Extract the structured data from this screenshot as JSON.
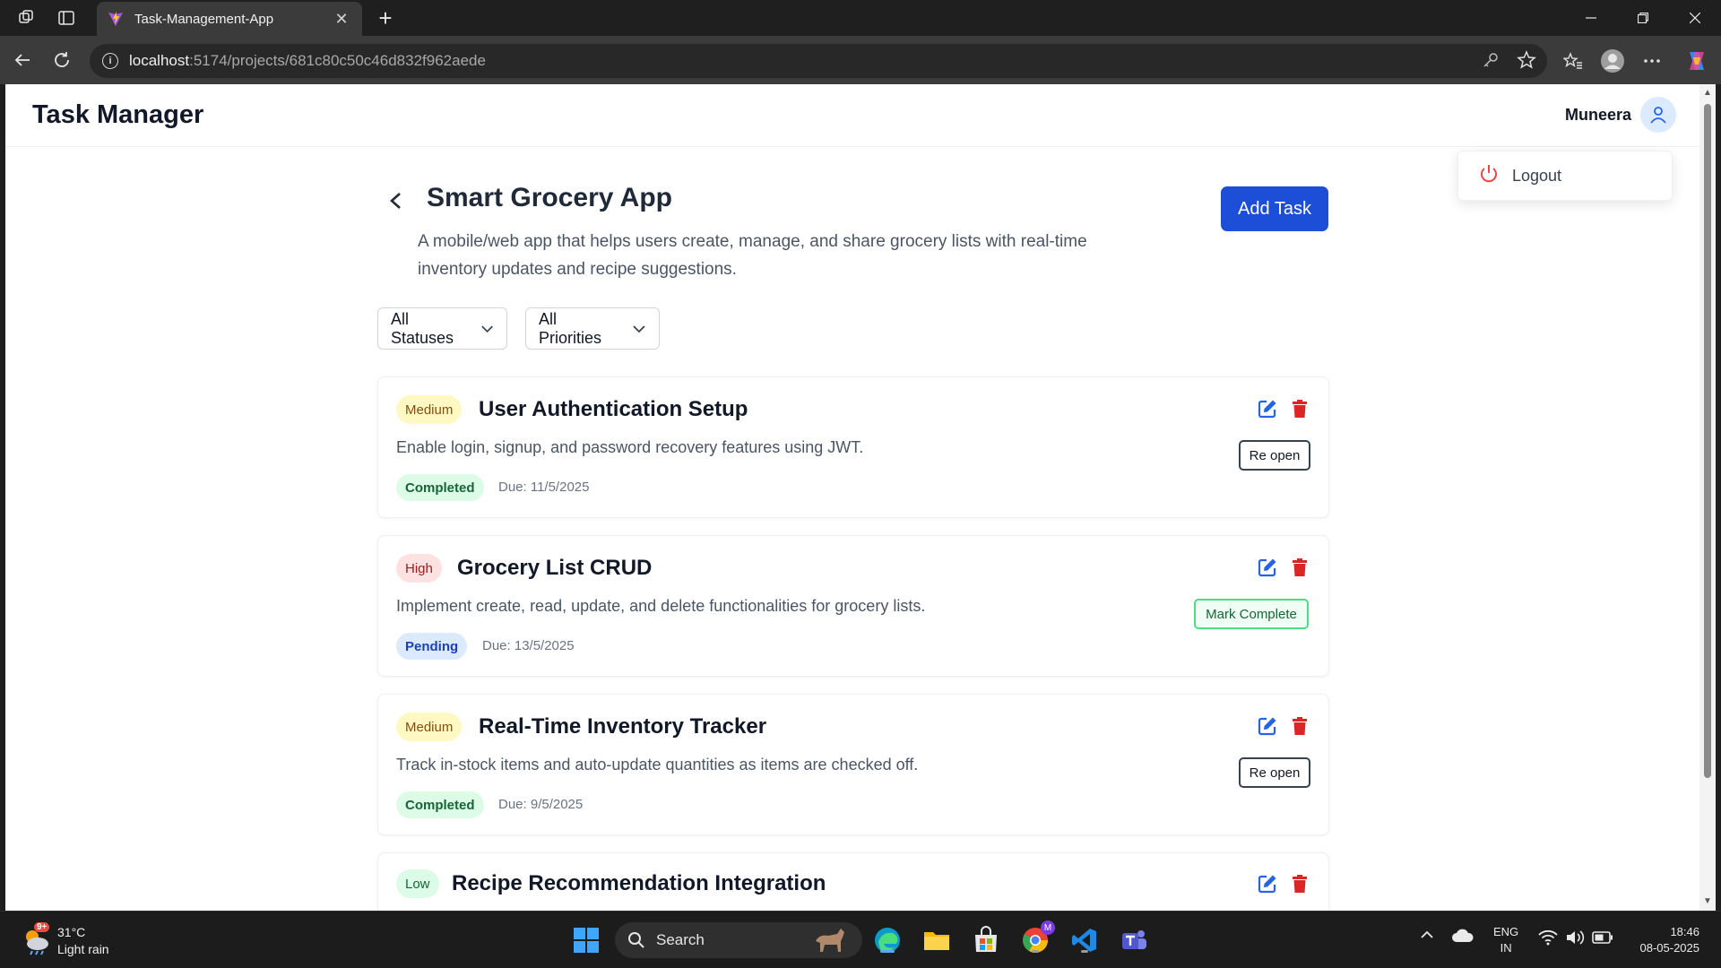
{
  "browser": {
    "tab_title": "Task-Management-App",
    "url_host": "localhost",
    "url_path": ":5174/projects/681c80c50c46d832f962aede"
  },
  "header": {
    "brand": "Task Manager",
    "user_name": "Muneera"
  },
  "menu": {
    "logout_label": "Logout"
  },
  "project": {
    "title": "Smart Grocery App",
    "description": "A mobile/web app that helps users create, manage, and share grocery lists with real-time inventory updates and recipe suggestions.",
    "add_task_label": "Add Task"
  },
  "filters": {
    "status": "All Statuses",
    "priority": "All Priorities"
  },
  "tasks": [
    {
      "priority": "Medium",
      "title": "User Authentication Setup",
      "description": "Enable login, signup, and password recovery features using JWT.",
      "status": "Completed",
      "due": "Due: 11/5/2025",
      "action": "Re open"
    },
    {
      "priority": "High",
      "title": "Grocery List CRUD",
      "description": "Implement create, read, update, and delete functionalities for grocery lists.",
      "status": "Pending",
      "due": "Due: 13/5/2025",
      "action": "Mark Complete"
    },
    {
      "priority": "Medium",
      "title": "Real-Time Inventory Tracker",
      "description": "Track in-stock items and auto-update quantities as items are checked off.",
      "status": "Completed",
      "due": "Due: 9/5/2025",
      "action": "Re open"
    },
    {
      "priority": "Low",
      "title": "Recipe Recommendation Integration"
    }
  ],
  "taskbar": {
    "weather_badge": "9+",
    "temperature": "31°C",
    "condition": "Light rain",
    "search_label": "Search",
    "lang_top": "ENG",
    "lang_bottom": "IN",
    "time": "18:46",
    "date": "08-05-2025",
    "chrome_badge": "M"
  },
  "colors": {
    "accent": "#1d4ed8",
    "delete": "#dc2626",
    "edit": "#2563eb"
  }
}
